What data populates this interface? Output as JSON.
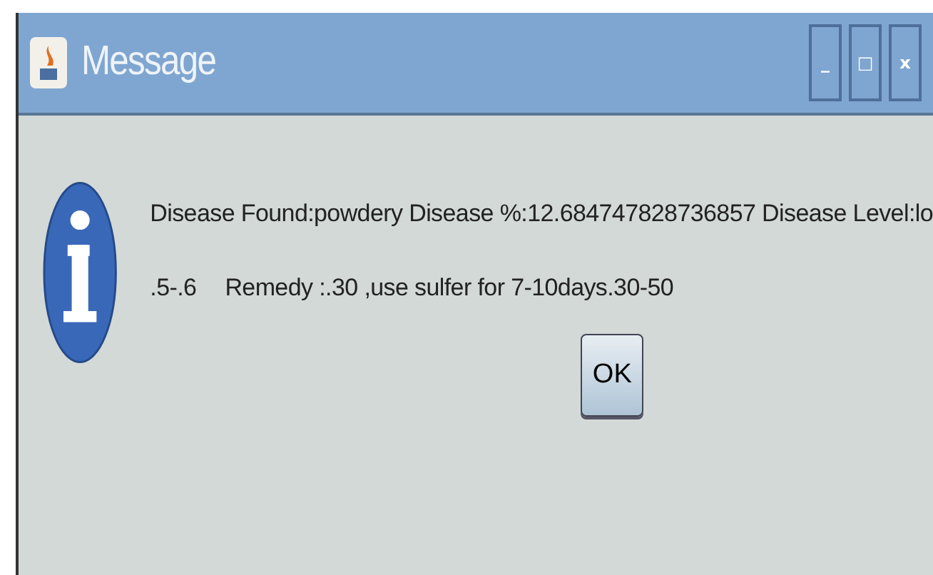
{
  "window": {
    "title": "Message",
    "controls": [
      "_",
      "□",
      "x"
    ]
  },
  "message": {
    "lines": [
      [
        "Disease Found:powdery Disease %:12.684747828736857 Disease Level:lo"
      ],
      [
        ".5-.6",
        "Remedy :.30 ,use sulfer for 7-10days.30-50"
      ]
    ]
  },
  "buttons": [
    "OK"
  ]
}
